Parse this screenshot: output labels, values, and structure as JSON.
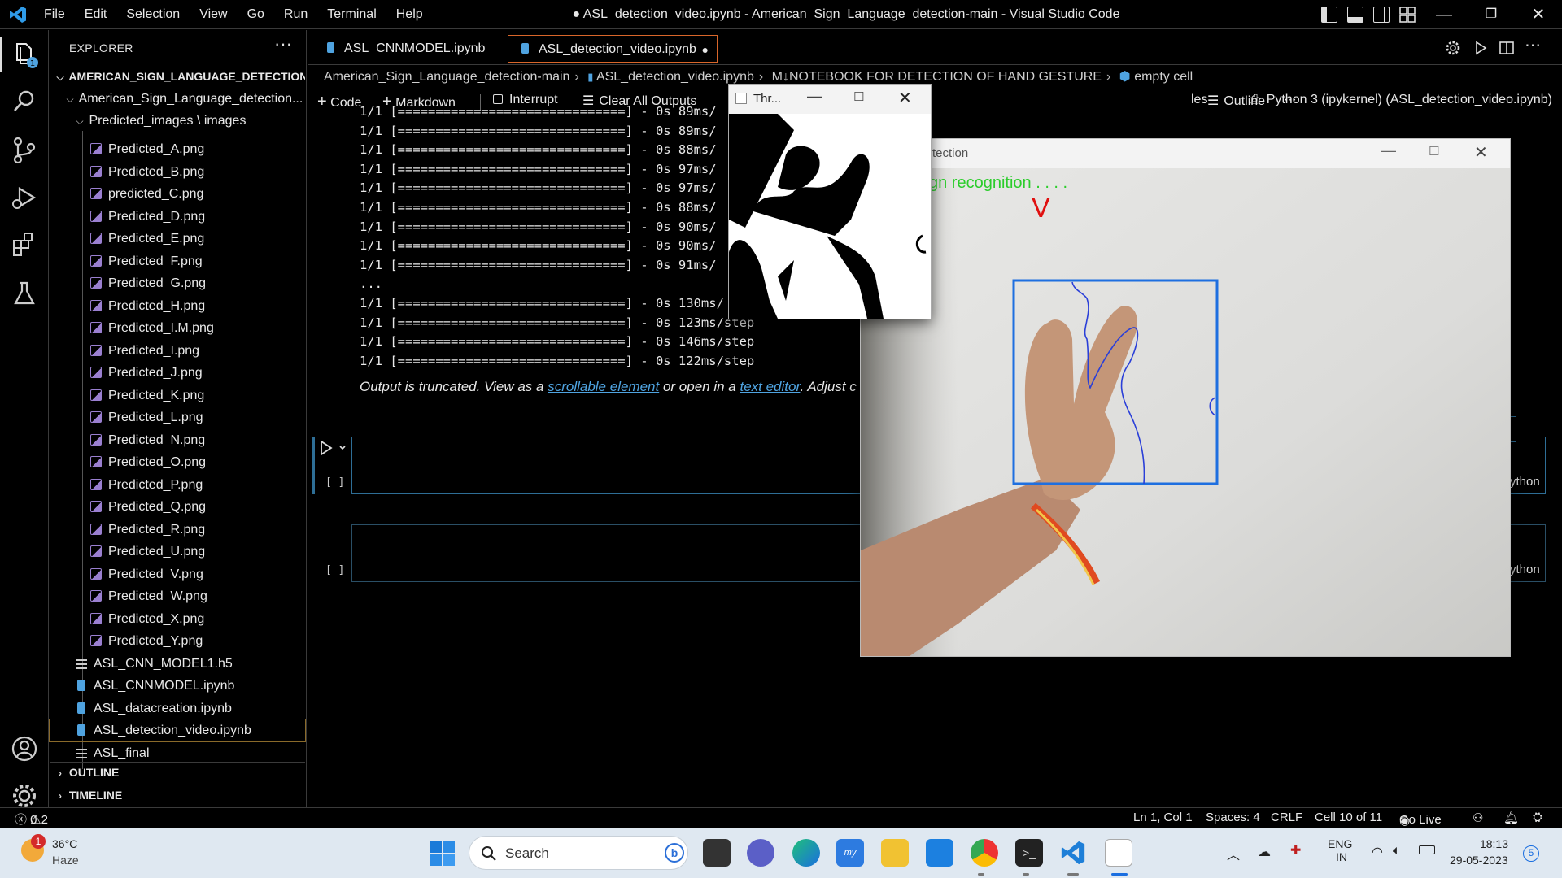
{
  "window": {
    "title": "● ASL_detection_video.ipynb - American_Sign_Language_detection-main - Visual Studio Code",
    "menu": [
      "File",
      "Edit",
      "Selection",
      "View",
      "Go",
      "Run",
      "Terminal",
      "Help"
    ]
  },
  "explorer": {
    "header": "EXPLORER",
    "more": "···",
    "root": "AMERICAN_SIGN_LANGUAGE_DETECTION-...",
    "subfolder": "American_Sign_Language_detection...",
    "images_folder": "Predicted_images \\ images",
    "image_files": [
      "Predicted_A.png",
      "Predicted_B.png",
      "predicted_C.png",
      "Predicted_D.png",
      "Predicted_E.png",
      "Predicted_F.png",
      "Predicted_G.png",
      "Predicted_H.png",
      "Predicted_I.M.png",
      "Predicted_I.png",
      "Predicted_J.png",
      "Predicted_K.png",
      "Predicted_L.png",
      "Predicted_N.png",
      "Predicted_O.png",
      "Predicted_P.png",
      "Predicted_Q.png",
      "Predicted_R.png",
      "Predicted_U.png",
      "Predicted_V.png",
      "Predicted_W.png",
      "Predicted_X.png",
      "Predicted_Y.png"
    ],
    "files": [
      {
        "name": "ASL_CNN_MODEL1.h5",
        "type": "txt"
      },
      {
        "name": "ASL_CNNMODEL.ipynb",
        "type": "nb"
      },
      {
        "name": "ASL_datacreation.ipynb",
        "type": "nb"
      },
      {
        "name": "ASL_detection_video.ipynb",
        "type": "nb"
      },
      {
        "name": "ASL_final",
        "type": "txt"
      }
    ],
    "outline": "OUTLINE",
    "timeline": "TIMELINE",
    "accounts_badge": "1"
  },
  "tabs": [
    {
      "label": "ASL_CNNMODEL.ipynb"
    },
    {
      "label": "ASL_detection_video.ipynb"
    }
  ],
  "breadcrumb": [
    "American_Sign_Language_detection-main",
    "ASL_detection_video.ipynb",
    "M↓NOTEBOOK FOR DETECTION OF HAND GESTURE",
    "empty cell"
  ],
  "toolbar": {
    "code": "Code",
    "markdown": "Markdown",
    "interrupt": "Interrupt",
    "clear": "Clear All Outputs",
    "variables_tail": "les",
    "outline": "Outline",
    "more": "···",
    "kernel": "Python 3 (ipykernel) (ASL_detection_video.ipynb)"
  },
  "output_lines": [
    "1/1 [==============================] - 0s 89ms/",
    "1/1 [==============================] - 0s 89ms/",
    "1/1 [==============================] - 0s 88ms/",
    "1/1 [==============================] - 0s 97ms/",
    "1/1 [==============================] - 0s 97ms/",
    "1/1 [==============================] - 0s 88ms/",
    "1/1 [==============================] - 0s 90ms/",
    "1/1 [==============================] - 0s 90ms/",
    "1/1 [==============================] - 0s 91ms/",
    "...",
    "1/1 [==============================] - 0s 130ms/",
    "1/1 [==============================] - 0s 123ms/step",
    "1/1 [==============================] - 0s 146ms/step",
    "1/1 [==============================] - 0s 122ms/step"
  ],
  "truncated": {
    "prefix": "Output is truncated. View as a ",
    "link1": "scrollable element",
    "middle": " or open in a ",
    "link2": "text editor",
    "suffix": ". Adjust c"
  },
  "cells": [
    {
      "bracket": "[ ]",
      "lang": "ython"
    },
    {
      "bracket": "[ ]",
      "lang": "ython"
    }
  ],
  "thresh_window": {
    "title": "Thr..."
  },
  "camera_window": {
    "title": "tection",
    "overlay_text": "gn  recognition . . . .",
    "prediction": "V"
  },
  "statusbar": {
    "errors": "0",
    "warnings": "2",
    "position": "Ln 1, Col 1",
    "spaces": "Spaces: 4",
    "eol": "CRLF",
    "cell": "Cell 10 of 11",
    "golive": "Go Live"
  },
  "taskbar": {
    "weather_temp": "36°C",
    "weather_desc": "Haze",
    "weather_badge": "1",
    "search_placeholder": "Search",
    "lang_top": "ENG",
    "lang_bottom": "IN",
    "time": "18:13",
    "date": "29-05-2023",
    "notif_count": "5"
  },
  "colors": {
    "accent": "#4fa3e0",
    "cell_border": "#2e6e96",
    "taskbar": "#dfe8f1",
    "box": "#1e6fe0",
    "prediction": "#e01010"
  }
}
